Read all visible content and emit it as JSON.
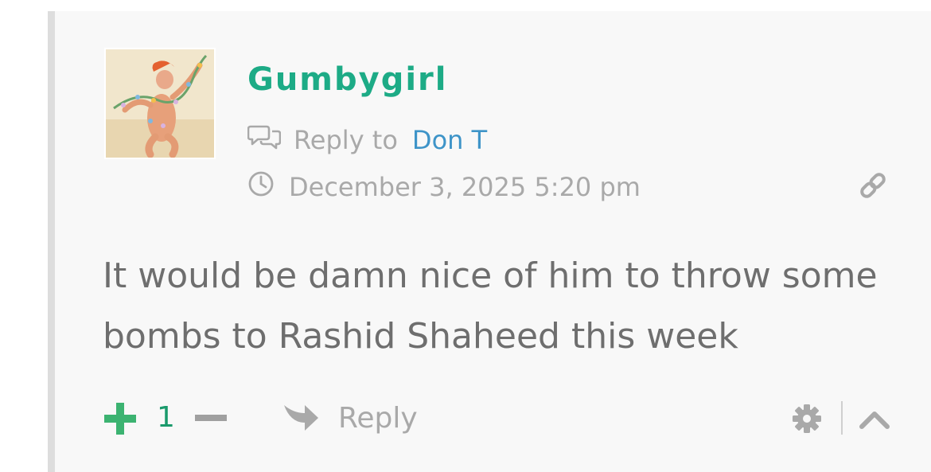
{
  "comment": {
    "author": "Gumbygirl",
    "reply_to_label": "Reply to",
    "reply_to_name": "Don T",
    "date": "December 3, 2025 5:20 pm",
    "text": "It would be damn nice of him to throw some bombs to Rashid Shaheed this week",
    "vote_count": "1",
    "reply_label": "Reply"
  },
  "icons": {
    "reply_to": "comments-icon",
    "date": "clock-icon",
    "permalink": "link-icon",
    "vote_up": "plus-icon",
    "vote_down": "minus-icon",
    "reply": "share-arrow-icon",
    "settings": "gear-icon",
    "collapse": "chevron-up-icon"
  },
  "colors": {
    "author": "#1dab86",
    "link": "#3e94c8",
    "vote_up": "#3cb371",
    "vote_count": "#1a9a6c",
    "muted": "#a9a9a9",
    "body_text": "#6e6e6e",
    "background": "#f8f8f8",
    "border": "#dddddd"
  }
}
